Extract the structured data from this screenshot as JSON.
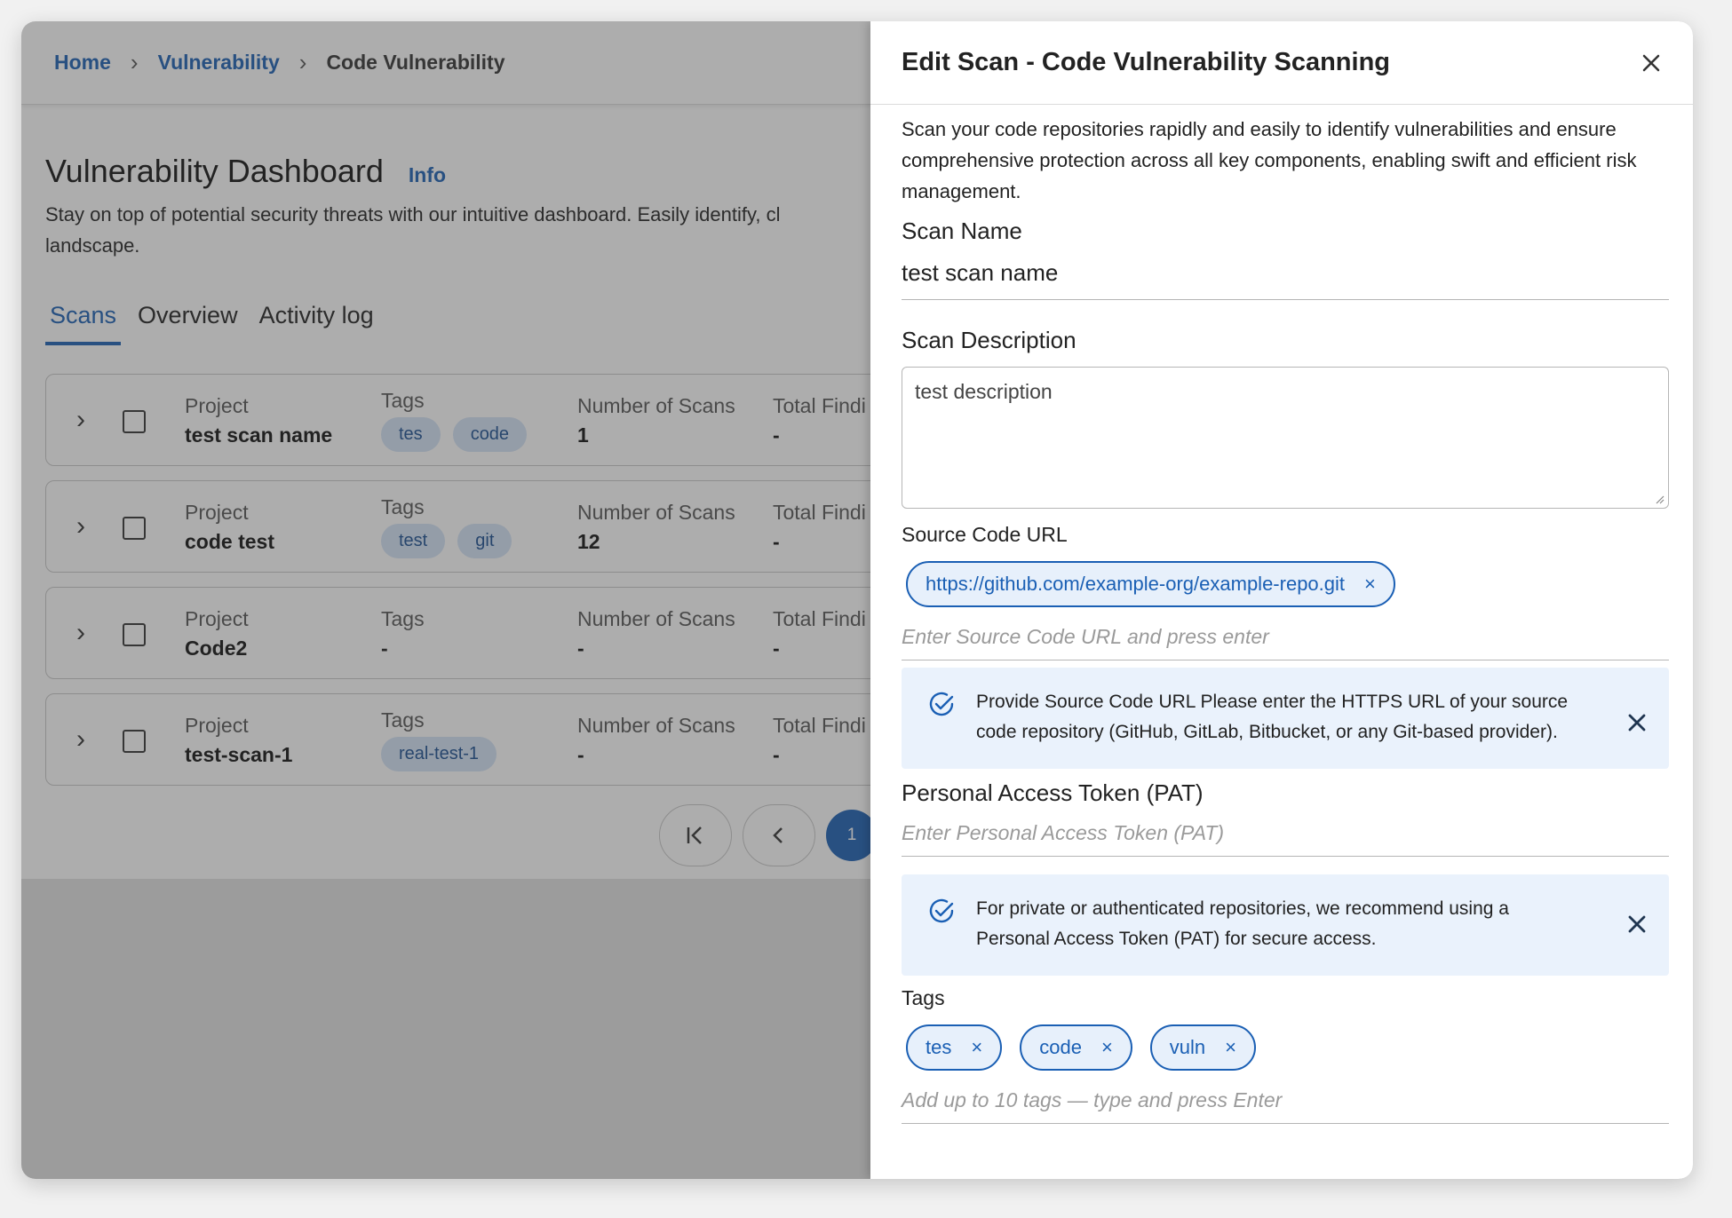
{
  "breadcrumb": {
    "home": "Home",
    "vulnerability": "Vulnerability",
    "current": "Code Vulnerability",
    "separator": "›"
  },
  "dashboard": {
    "title": "Vulnerability Dashboard",
    "info_link": "Info",
    "description": "Stay on top of potential security threats with our intuitive dashboard. Easily identify, cl",
    "description_line2": "landscape.",
    "tabs": [
      "Scans",
      "Overview",
      "Activity log"
    ],
    "active_tab": "Scans",
    "column_labels": {
      "project": "Project",
      "tags": "Tags",
      "count": "Number of Scans",
      "findings": "Total Findi"
    },
    "rows": [
      {
        "project": "test scan name",
        "tags": [
          "tes",
          "code"
        ],
        "count": "1",
        "findings": "-"
      },
      {
        "project": "code test",
        "tags": [
          "test",
          "git"
        ],
        "count": "12",
        "findings": "-"
      },
      {
        "project": "Code2",
        "tags_text": "-",
        "count": "-",
        "findings": "-"
      },
      {
        "project": "test-scan-1",
        "tags": [
          "real-test-1"
        ],
        "count": "-",
        "findings": "-"
      }
    ],
    "pagination": {
      "current_page": "1"
    }
  },
  "drawer": {
    "title": "Edit Scan - Code Vulnerability Scanning",
    "description": "Scan your code repositories rapidly and easily to identify vulnerabilities and ensure comprehensive protection across all key components, enabling swift and efficient risk management.",
    "scan_name_label": "Scan Name",
    "scan_name_value": "test scan name",
    "scan_description_label": "Scan Description",
    "scan_description_value": "test description",
    "source_url_label": "Source Code URL",
    "source_urls": [
      "https://github.com/example-org/example-repo.git"
    ],
    "source_url_placeholder": "Enter Source Code URL and press enter",
    "source_url_alert": "Provide Source Code URL Please enter the HTTPS URL of your source code repository (GitHub, GitLab, Bitbucket, or any Git-based provider).",
    "pat_label": "Personal Access Token (PAT)",
    "pat_placeholder": "Enter Personal Access Token (PAT)",
    "pat_alert": "For private or authenticated repositories, we recommend using a Personal Access Token (PAT) for secure access.",
    "tags_label": "Tags",
    "tags": [
      "tes",
      "code",
      "vuln"
    ],
    "tags_placeholder": "Add up to 10 tags — type and press Enter",
    "chip_remove_symbol": "×"
  },
  "colors": {
    "accent": "#1a5fb4",
    "tag_bg": "#d4e3f7",
    "alert_bg": "#eaf2fc"
  }
}
